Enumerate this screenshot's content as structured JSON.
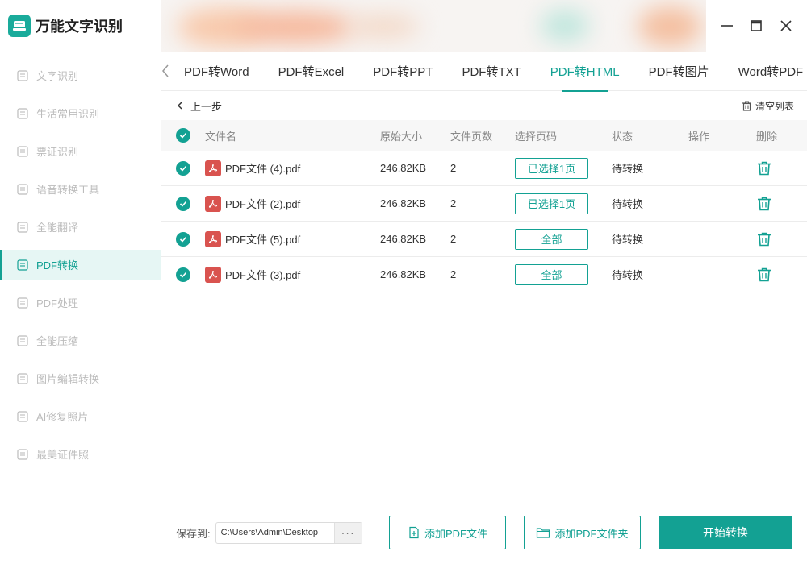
{
  "app": {
    "title": "万能文字识别",
    "accent": "#13a193"
  },
  "sidebar": {
    "items": [
      {
        "label": "文字识别",
        "icon": "scan-text-icon",
        "active": false
      },
      {
        "label": "生活常用识别",
        "icon": "scan-life-icon",
        "active": false
      },
      {
        "label": "票证识别",
        "icon": "ticket-scan-icon",
        "active": false
      },
      {
        "label": "语音转换工具",
        "icon": "voice-convert-icon",
        "active": false
      },
      {
        "label": "全能翻译",
        "icon": "translate-icon",
        "active": false
      },
      {
        "label": "PDF转换",
        "icon": "pdf-convert-icon",
        "active": true
      },
      {
        "label": "PDF处理",
        "icon": "pdf-process-icon",
        "active": false
      },
      {
        "label": "全能压缩",
        "icon": "compress-icon",
        "active": false
      },
      {
        "label": "图片编辑转换",
        "icon": "image-edit-icon",
        "active": false
      },
      {
        "label": "AI修复照片",
        "icon": "ai-repair-icon",
        "active": false
      },
      {
        "label": "最美证件照",
        "icon": "id-photo-icon",
        "active": false
      }
    ]
  },
  "tabs": [
    {
      "label": "PDF转Word",
      "active": false
    },
    {
      "label": "PDF转Excel",
      "active": false
    },
    {
      "label": "PDF转PPT",
      "active": false
    },
    {
      "label": "PDF转TXT",
      "active": false
    },
    {
      "label": "PDF转HTML",
      "active": true
    },
    {
      "label": "PDF转图片",
      "active": false
    },
    {
      "label": "Word转PDF",
      "active": false
    }
  ],
  "toolbar": {
    "back_label": "上一步",
    "clear_label": "清空列表"
  },
  "table": {
    "headers": {
      "name": "文件名",
      "size": "原始大小",
      "pages": "文件页数",
      "select": "选择页码",
      "status": "状态",
      "op": "操作",
      "delete": "删除"
    },
    "rows": [
      {
        "name": "PDF文件 (4).pdf",
        "size": "246.82KB",
        "pages": "2",
        "select": "已选择1页",
        "status": "待转换"
      },
      {
        "name": "PDF文件 (2).pdf",
        "size": "246.82KB",
        "pages": "2",
        "select": "已选择1页",
        "status": "待转换"
      },
      {
        "name": "PDF文件 (5).pdf",
        "size": "246.82KB",
        "pages": "2",
        "select": "全部",
        "status": "待转换"
      },
      {
        "name": "PDF文件 (3).pdf",
        "size": "246.82KB",
        "pages": "2",
        "select": "全部",
        "status": "待转换"
      }
    ]
  },
  "footer": {
    "save_label": "保存到:",
    "save_path": "C:\\Users\\Admin\\Desktop",
    "more_label": "···",
    "add_file_label": "添加PDF文件",
    "add_folder_label": "添加PDF文件夹",
    "start_label": "开始转换"
  }
}
